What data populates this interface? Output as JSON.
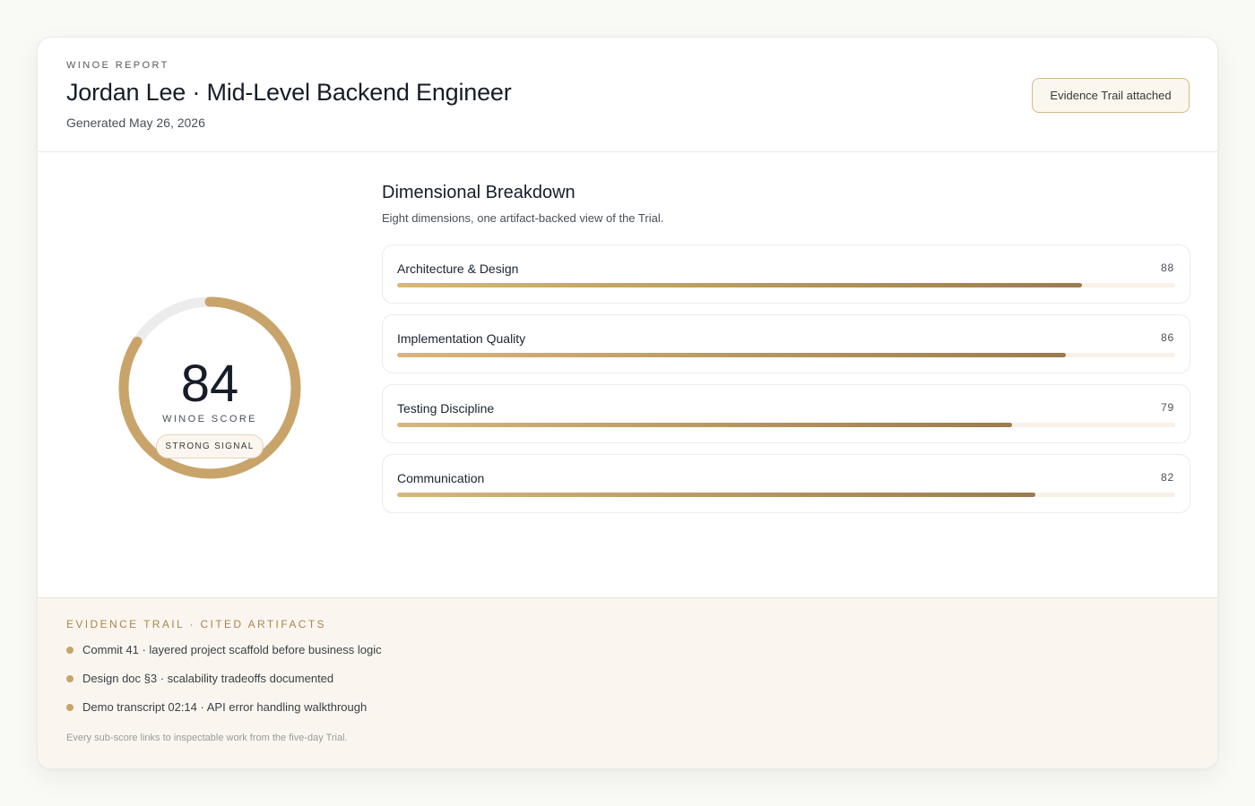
{
  "report": {
    "eyebrow": "WINOE REPORT",
    "title": "Jordan Lee · Mid-Level Backend Engineer",
    "generated": "Generated  May 26, 2026",
    "evidence_button": "Evidence Trail attached"
  },
  "score": {
    "value": "84",
    "progress": 0.84,
    "label": "WINOE SCORE",
    "signal": "STRONG SIGNAL"
  },
  "breakdown": {
    "title": "Dimensional Breakdown",
    "subtitle": "Eight dimensions, one artifact-backed  view of the Trial.",
    "items": [
      {
        "name": "Architecture  & Design",
        "score": "88",
        "value": 88
      },
      {
        "name": "Implementation  Quality",
        "score": "86",
        "value": 86
      },
      {
        "name": "Testing  Discipline",
        "score": "79",
        "value": 79
      },
      {
        "name": "Communication",
        "score": "82",
        "value": 82
      }
    ]
  },
  "evidence": {
    "title": "EVIDENCE TRAIL · CITED ARTIFACTS",
    "items": [
      "Commit 41 · layered project scaffold before business logic",
      "Design doc §3 · scalability tradeoffs documented",
      "Demo transcript 02:14 · API error handling walkthrough"
    ],
    "note": "Every sub-score links to inspectable work from the five-day Trial."
  },
  "colors": {
    "accent": "#c9a46a",
    "track": "#ececec",
    "page_bg": "#f9f9f6",
    "footer_bg": "#faf6ef"
  }
}
